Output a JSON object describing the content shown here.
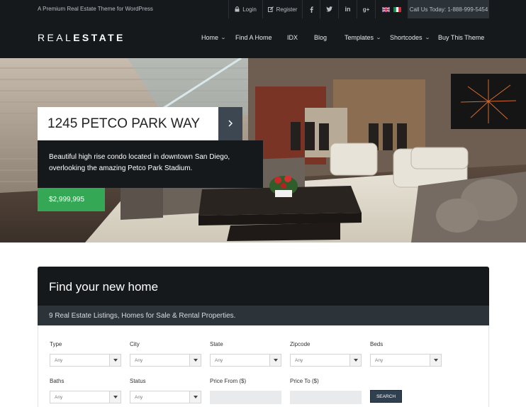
{
  "topbar": {
    "tagline": "A Premium Real Estate Theme for WordPress",
    "login_label": "Login",
    "register_label": "Register",
    "social": [
      "facebook-icon",
      "twitter-icon",
      "linkedin-icon",
      "google-plus-icon"
    ],
    "languages": [
      "english-flag",
      "italian-flag"
    ],
    "phone": "Call Us Today: 1-888-999-5454"
  },
  "header": {
    "logo_light": "REAL",
    "logo_bold": "ESTATE",
    "nav": {
      "home": "Home",
      "find_a_home": "Find A Home",
      "idx": "IDX",
      "blog": "Blog",
      "templates": "Templates",
      "shortcodes": "Shortcodes",
      "buy": "Buy This Theme"
    }
  },
  "hero": {
    "title": "1245 PETCO PARK WAY",
    "description": "Beautiful high rise condo located in downtown San Diego, overlooking the amazing Petco Park Stadium.",
    "price": "$2,999,995",
    "colors": {
      "price_bg": "#35a855",
      "dark_bg": "#16191c",
      "arrow_bg": "#3c4752"
    }
  },
  "search": {
    "title": "Find your new home",
    "subtitle": "9 Real Estate Listings, Homes for Sale & Rental Properties.",
    "fields": {
      "type": {
        "label": "Type",
        "value": "Any"
      },
      "city": {
        "label": "City",
        "value": "Any"
      },
      "state": {
        "label": "State",
        "value": "Any"
      },
      "zipcode": {
        "label": "Zipcode",
        "value": "Any"
      },
      "beds": {
        "label": "Beds",
        "value": "Any"
      },
      "baths": {
        "label": "Baths",
        "value": "Any"
      },
      "status": {
        "label": "Status",
        "value": "Any"
      },
      "price_from": {
        "label": "Price From ($)",
        "value": ""
      },
      "price_to": {
        "label": "Price To ($)",
        "value": ""
      }
    },
    "button_label": "SEARCH"
  }
}
